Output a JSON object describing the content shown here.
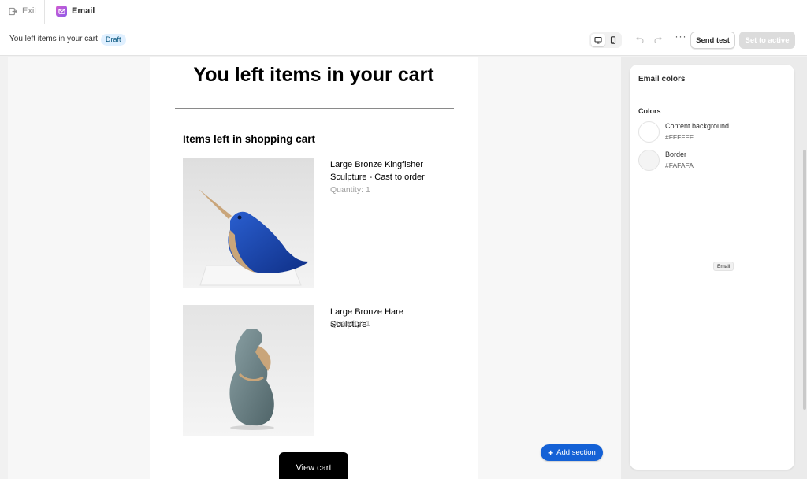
{
  "topbar": {
    "exit_label": "Exit",
    "app_name": "Email"
  },
  "toolbar": {
    "title": "You left items in your cart",
    "status_badge": "Draft",
    "send_test_label": "Send test",
    "set_active_label": "Set to active",
    "more_label": "···"
  },
  "email": {
    "heading": "You left items in your cart",
    "section_heading": "Items left in shopping cart",
    "products": [
      {
        "name": "Large Bronze Kingfisher Sculpture - Cast to order",
        "quantity": "Quantity: 1"
      },
      {
        "name": "Large Bronze Hare Sculpture",
        "quantity": "Quantity: 1"
      }
    ],
    "cta_label": "View cart"
  },
  "canvas": {
    "add_section_label": "Add section"
  },
  "panel": {
    "title": "Email colors",
    "colors_label": "Colors",
    "swatches": [
      {
        "name": "Content background",
        "hex": "#FFFFFF"
      },
      {
        "name": "Border",
        "hex": "#FAFAFA"
      }
    ],
    "tooltip": "Email"
  },
  "colors": {
    "accent": "#1461d6",
    "badge_bg": "#e0f0ff",
    "cta_bg": "#000000"
  }
}
